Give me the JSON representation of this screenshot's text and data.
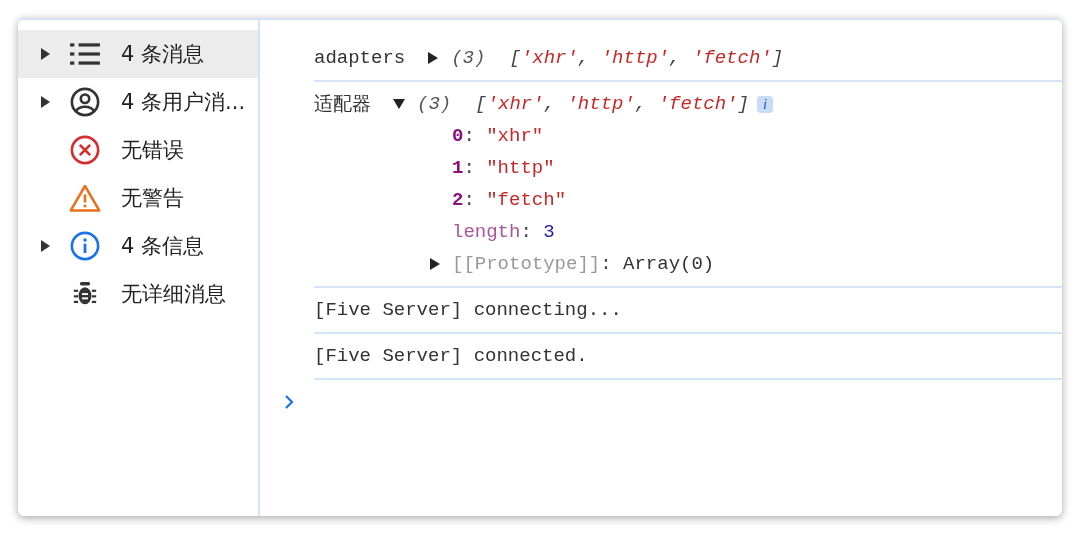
{
  "sidebar": {
    "items": [
      {
        "label": "4 条消息",
        "kind": "list",
        "expandable": true,
        "selected": true
      },
      {
        "label": "4 条用户消...",
        "kind": "user",
        "expandable": true,
        "selected": false
      },
      {
        "label": "无错误",
        "kind": "error",
        "expandable": false,
        "selected": false
      },
      {
        "label": "无警告",
        "kind": "warning",
        "expandable": false,
        "selected": false
      },
      {
        "label": "4 条信息",
        "kind": "info",
        "expandable": true,
        "selected": false
      },
      {
        "label": "无详细消息",
        "kind": "verbose",
        "expandable": false,
        "selected": false
      }
    ]
  },
  "console": {
    "entries": [
      {
        "kind": "array",
        "label": "adapters",
        "expanded": false,
        "count": "(3)",
        "preview": [
          {
            "text": "[",
            "kind": "punct"
          },
          {
            "text": "'xhr'",
            "kind": "string"
          },
          {
            "text": ", ",
            "kind": "punct"
          },
          {
            "text": "'http'",
            "kind": "string"
          },
          {
            "text": ", ",
            "kind": "punct"
          },
          {
            "text": "'fetch'",
            "kind": "string"
          },
          {
            "text": "]",
            "kind": "punct"
          }
        ]
      },
      {
        "kind": "array",
        "label": "适配器",
        "expanded": true,
        "count": "(3)",
        "preview": [
          {
            "text": "[",
            "kind": "punct"
          },
          {
            "text": "'xhr'",
            "kind": "string"
          },
          {
            "text": ", ",
            "kind": "punct"
          },
          {
            "text": "'http'",
            "kind": "string"
          },
          {
            "text": ", ",
            "kind": "punct"
          },
          {
            "text": "'fetch'",
            "kind": "string"
          },
          {
            "text": "]",
            "kind": "punct"
          }
        ],
        "badge": "i",
        "properties": [
          {
            "kind": "index",
            "key": "0",
            "sep": ": ",
            "value": "\"xhr\""
          },
          {
            "kind": "index",
            "key": "1",
            "sep": ": ",
            "value": "\"http\""
          },
          {
            "kind": "index",
            "key": "2",
            "sep": ": ",
            "value": "\"fetch\""
          },
          {
            "kind": "length",
            "key": "length",
            "sep": ": ",
            "value": "3"
          },
          {
            "kind": "prototype",
            "key": "[[Prototype]]",
            "sep": ": ",
            "value": "Array(0)"
          }
        ]
      },
      {
        "kind": "text",
        "text": "[Five Server] connecting..."
      },
      {
        "kind": "text",
        "text": "[Five Server] connected."
      }
    ]
  }
}
